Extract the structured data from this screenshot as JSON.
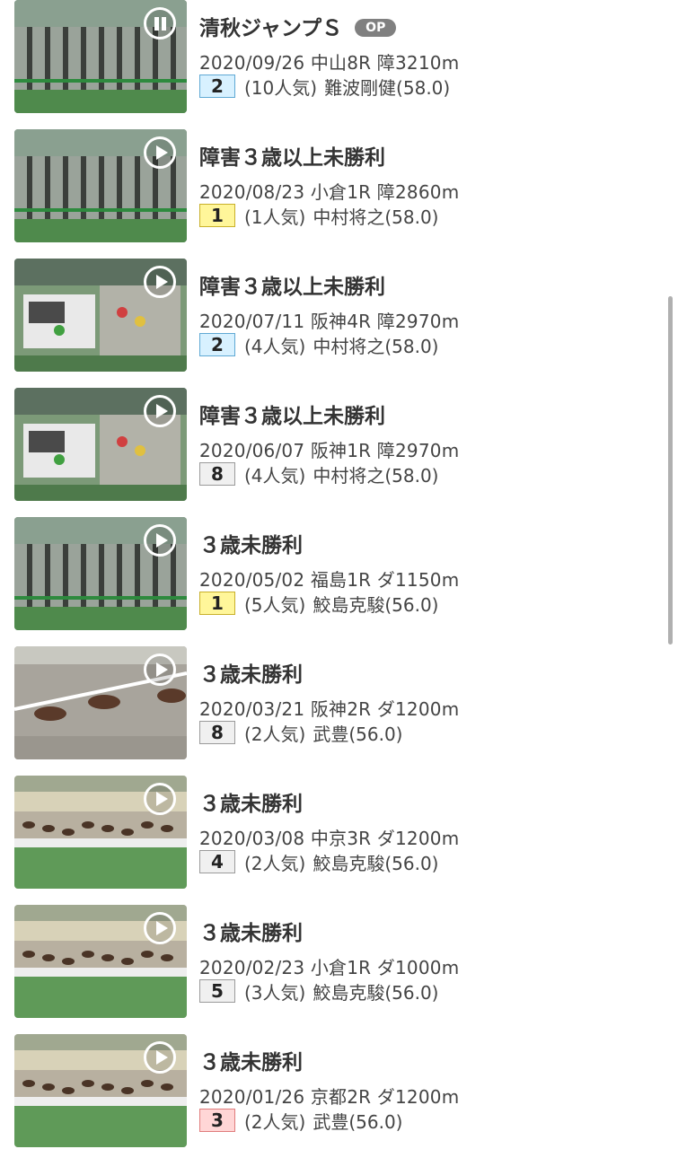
{
  "races": [
    {
      "name": "清秋ジャンプＳ",
      "grade": "OP",
      "info": "2020/09/26 中山8R 障3210m",
      "place": "2",
      "popularity": "(10人気)",
      "jockey": "難波剛健(58.0)",
      "scene": "gate",
      "player": "pause-icon"
    },
    {
      "name": "障害３歳以上未勝利",
      "grade": "",
      "info": "2020/08/23 小倉1R 障2860m",
      "place": "1",
      "popularity": "(1人気)",
      "jockey": "中村将之(58.0)",
      "scene": "gate",
      "player": "play-icon"
    },
    {
      "name": "障害３歳以上未勝利",
      "grade": "",
      "info": "2020/07/11 阪神4R 障2970m",
      "place": "2",
      "popularity": "(4人気)",
      "jockey": "中村将之(58.0)",
      "scene": "truck",
      "player": "play-icon"
    },
    {
      "name": "障害３歳以上未勝利",
      "grade": "",
      "info": "2020/06/07 阪神1R 障2970m",
      "place": "8",
      "popularity": "(4人気)",
      "jockey": "中村将之(58.0)",
      "scene": "truck",
      "player": "play-icon"
    },
    {
      "name": "３歳未勝利",
      "grade": "",
      "info": "2020/05/02 福島1R ダ1150m",
      "place": "1",
      "popularity": "(5人気)",
      "jockey": "鮫島克駿(56.0)",
      "scene": "gate",
      "player": "play-icon"
    },
    {
      "name": "３歳未勝利",
      "grade": "",
      "info": "2020/03/21 阪神2R ダ1200m",
      "place": "8",
      "popularity": "(2人気)",
      "jockey": "武豊(56.0)",
      "scene": "closeup",
      "player": "play-icon"
    },
    {
      "name": "３歳未勝利",
      "grade": "",
      "info": "2020/03/08 中京3R ダ1200m",
      "place": "4",
      "popularity": "(2人気)",
      "jockey": "鮫島克駿(56.0)",
      "scene": "track",
      "player": "play-icon"
    },
    {
      "name": "３歳未勝利",
      "grade": "",
      "info": "2020/02/23 小倉1R ダ1000m",
      "place": "5",
      "popularity": "(3人気)",
      "jockey": "鮫島克駿(56.0)",
      "scene": "track",
      "player": "play-icon"
    },
    {
      "name": "３歳未勝利",
      "grade": "",
      "info": "2020/01/26 京都2R ダ1200m",
      "place": "3",
      "popularity": "(2人気)",
      "jockey": "武豊(56.0)",
      "scene": "track",
      "player": "play-icon"
    }
  ],
  "colors": {
    "place_1": "#fff69a",
    "place_2": "#d8f1ff",
    "place_3": "#ffd6d6",
    "place_other": "#f0f0f0",
    "badge": "#808080"
  }
}
